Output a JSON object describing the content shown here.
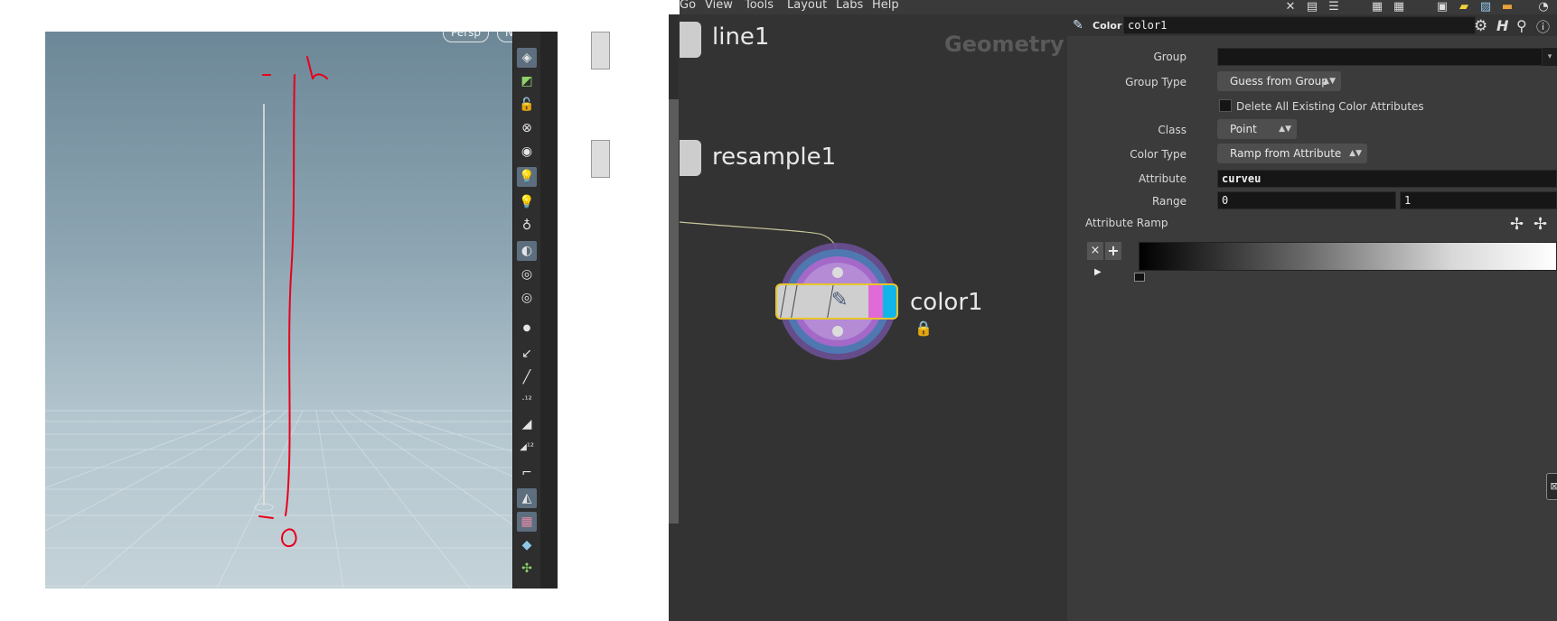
{
  "viewport": {
    "pills": [
      "Persp",
      "No cam"
    ],
    "annotation_number": "1",
    "annotation_zero": "0"
  },
  "menubar": {
    "items": [
      "Go",
      "View",
      "Tools",
      "Layout",
      "Labs",
      "Help"
    ]
  },
  "network": {
    "context_label": "Geometry",
    "nodes": {
      "line": "line1",
      "resample": "resample1",
      "color": "color1"
    }
  },
  "params": {
    "node_type": "Color",
    "node_name": "color1",
    "fields": {
      "group_label": "Group",
      "group_value": "",
      "group_type_label": "Group Type",
      "group_type_value": "Guess from Group",
      "delete_label": "Delete All Existing Color Attributes",
      "class_label": "Class",
      "class_value": "Point",
      "color_type_label": "Color Type",
      "color_type_value": "Ramp from Attribute",
      "attribute_label": "Attribute",
      "attribute_value": "curveu",
      "range_label": "Range",
      "range_min": "0",
      "range_max": "1",
      "ramp_label": "Attribute Ramp"
    }
  },
  "colors": {
    "node_selected_border": "#e8c42a",
    "annotation_red": "#e8001c",
    "node_pink": "#e06ad6",
    "node_cyan": "#12b5ea"
  }
}
